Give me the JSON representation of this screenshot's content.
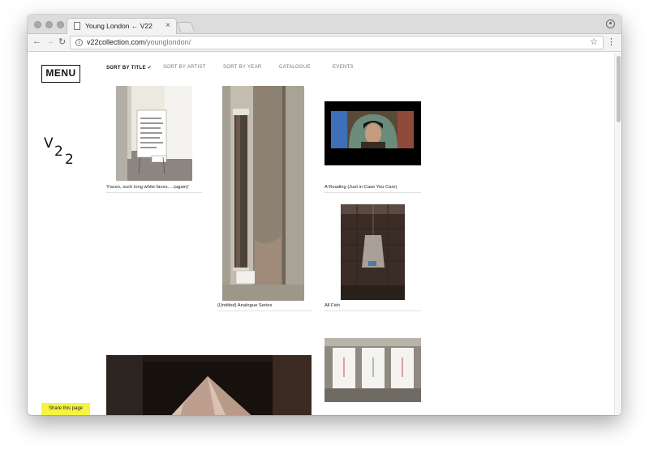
{
  "browser": {
    "tab_title": "Young London ← V22",
    "tab_close": "×",
    "url_host": "v22collection.com",
    "url_path": "/younglondon/",
    "back": "←",
    "forward": "→",
    "reload": "↻",
    "star": "☆",
    "menu": "⋮",
    "info": "i"
  },
  "site": {
    "menu_label": "MENU",
    "logo": {
      "v": "V",
      "two_a": "2",
      "two_b": "2"
    },
    "share_label": "Share this page"
  },
  "sort_nav": {
    "title": "SORT BY TITLE",
    "title_check": "✓",
    "artist": "SORT BY ARTIST",
    "year": "SORT BY YEAR",
    "catalogue": "CATALOGUE",
    "events": "EVENTS"
  },
  "works": [
    {
      "caption": "'Faces, such long white faces….(again)'"
    },
    {
      "caption": "(Untitled) Analogue Series"
    },
    {
      "caption": "A Reading (Just in Case You Care)"
    },
    {
      "caption": "All Fish"
    },
    {
      "caption": ""
    },
    {
      "caption": ""
    }
  ],
  "colors": {
    "share_bg": "#f6f442",
    "text": "#111111"
  }
}
